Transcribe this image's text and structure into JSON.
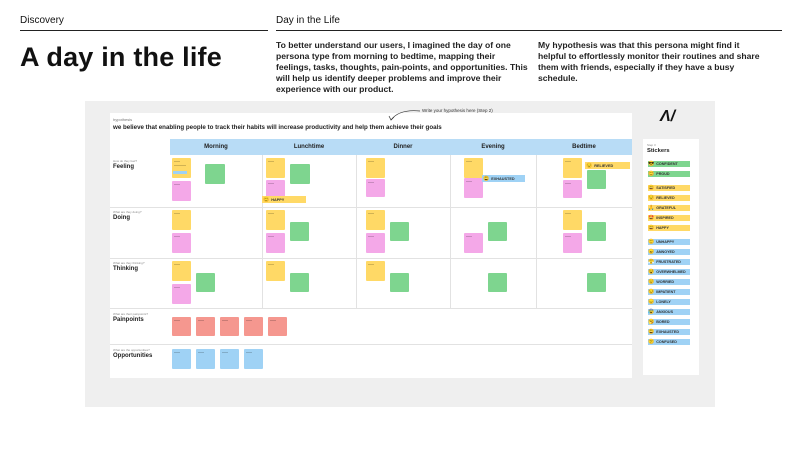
{
  "header": {
    "section_left": "Discovery",
    "section_right": "Day in the Life",
    "title": "A day in the life",
    "intro": "To better understand our users, I imagined the day of one persona type from morning to bedtime, mapping their feelings, tasks, thoughts, pain-points, and opportunities. This will help us identify deeper problems and improve their experience with our product.",
    "hypothesis_intro": "My hypothesis was that this persona might find it helpful to effortlessly monitor their routines and share them with friends, especially if they have a busy schedule."
  },
  "board": {
    "hypothesis_label": "hypothesis",
    "hypothesis": "we believe that enabling people to track their habits will increase productivity and help them achieve their goals",
    "annotation": "Write your hypothesis here (Step 2)",
    "columns": [
      "Morning",
      "Lunchtime",
      "Dinner",
      "Evening",
      "Bedtime"
    ],
    "rows": [
      {
        "hint": "How do they feel?",
        "label": "Feeling"
      },
      {
        "hint": "What are they doing?",
        "label": "Doing"
      },
      {
        "hint": "What are they thinking?",
        "label": "Thinking"
      },
      {
        "hint": "What are their painpoints?",
        "label": "Painpoints"
      },
      {
        "hint": "What are the opportunities?",
        "label": "Opportunities"
      }
    ],
    "placed_tags": [
      {
        "emoji": "😊",
        "label": "HAPPY"
      },
      {
        "emoji": "😌",
        "label": "RELIEVED"
      },
      {
        "emoji": "😩",
        "label": "EXHAUSTED"
      }
    ],
    "logo": "Λ/"
  },
  "stickers": {
    "hint": "Step 3",
    "title": "Stickers",
    "items": [
      {
        "emoji": "😎",
        "label": "CONFIDENT",
        "color": "#7ed58f"
      },
      {
        "emoji": "😊",
        "label": "PROUD",
        "color": "#7ed58f"
      },
      {
        "emoji": "😀",
        "label": "SATISFIED",
        "color": "#ffd966"
      },
      {
        "emoji": "😌",
        "label": "RELIEVED",
        "color": "#ffd966"
      },
      {
        "emoji": "🙏",
        "label": "GRATEFUL",
        "color": "#ffd966"
      },
      {
        "emoji": "🤩",
        "label": "INSPIRED",
        "color": "#ffd966"
      },
      {
        "emoji": "😄",
        "label": "HAPPY",
        "color": "#ffd966"
      },
      {
        "emoji": "🙁",
        "label": "UNHAPPY",
        "color": "#9fd2f5"
      },
      {
        "emoji": "😠",
        "label": "ANNOYED",
        "color": "#9fd2f5"
      },
      {
        "emoji": "😤",
        "label": "FRUSTRATED",
        "color": "#9fd2f5"
      },
      {
        "emoji": "😵",
        "label": "OVERWHELMED",
        "color": "#9fd2f5"
      },
      {
        "emoji": "😟",
        "label": "WORRIED",
        "color": "#9fd2f5"
      },
      {
        "emoji": "😒",
        "label": "IMPATIENT",
        "color": "#9fd2f5"
      },
      {
        "emoji": "😞",
        "label": "LONELY",
        "color": "#9fd2f5"
      },
      {
        "emoji": "😰",
        "label": "ANXIOUS",
        "color": "#9fd2f5"
      },
      {
        "emoji": "🥱",
        "label": "BORED",
        "color": "#9fd2f5"
      },
      {
        "emoji": "😩",
        "label": "EXHAUSTED",
        "color": "#9fd2f5"
      },
      {
        "emoji": "😕",
        "label": "CONFUSED",
        "color": "#9fd2f5"
      }
    ]
  }
}
